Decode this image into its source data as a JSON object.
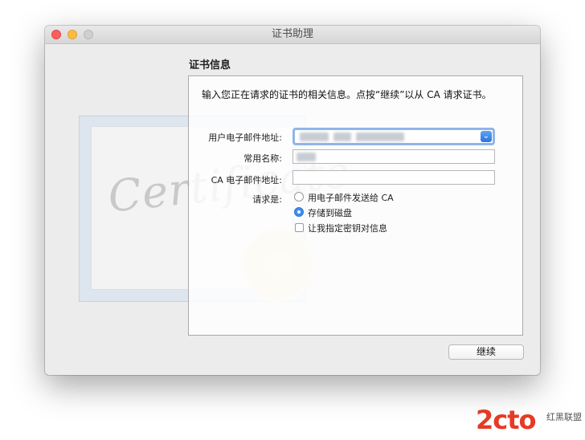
{
  "window": {
    "title": "证书助理"
  },
  "cert_art": {
    "word": "Certificate"
  },
  "section": {
    "heading": "证书信息"
  },
  "form": {
    "instruction": "输入您正在请求的证书的相关信息。点按“继续”以从 CA 请求证书。",
    "labels": {
      "user_email": "用户电子邮件地址:",
      "common_name": "常用名称:",
      "ca_email": "CA 电子邮件地址:",
      "request_is": "请求是:"
    },
    "options": {
      "email_to_ca": "用电子邮件发送给 CA",
      "save_to_disk": "存储到磁盘",
      "let_me_specify": "让我指定密钥对信息"
    },
    "selected_option": "save_to_disk"
  },
  "actions": {
    "continue_label": "继续"
  },
  "watermark": {
    "main": "2cto",
    "sub": "红黑联盟"
  },
  "colors": {
    "accent": "#3b8cf2",
    "watermark": "#e53b25"
  }
}
